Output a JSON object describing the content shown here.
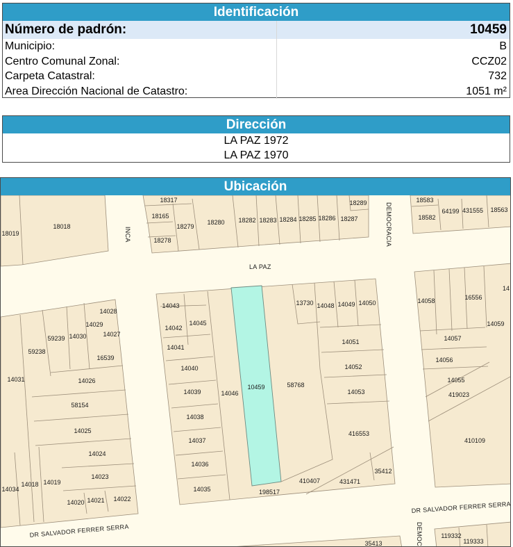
{
  "identificacion": {
    "title": "Identificación",
    "rows": [
      {
        "label": "Número de padrón:",
        "value": "10459"
      },
      {
        "label": "Municipio:",
        "value": "B"
      },
      {
        "label": "Centro Comunal Zonal:",
        "value": "CCZ02"
      },
      {
        "label": "Carpeta Catastral:",
        "value": "732"
      },
      {
        "label": "Area Dirección Nacional de Catastro:",
        "value": "1051 m²"
      }
    ]
  },
  "direccion": {
    "title": "Dirección",
    "lines": [
      "LA PAZ 1972",
      "LA PAZ 1970"
    ]
  },
  "ubicacion": {
    "title": "Ubicación",
    "map": {
      "highlight_color": "#b3f5e4",
      "block_color": "#f6ead0",
      "street_color": "#fffbeb",
      "streets": [
        "LA PAZ",
        "INCA",
        "DEMOCRACIA",
        "DR SALVADOR FERRER SERRA",
        "DR SALVADOR FERRER SERRA",
        "DEMOCR"
      ],
      "parcels": [
        "10459",
        "18317",
        "18165",
        "18279",
        "18278",
        "18280",
        "18282",
        "18283",
        "18284",
        "18285",
        "18286",
        "18287",
        "18289",
        "18018",
        "18019",
        "18583",
        "18582",
        "64199",
        "431555",
        "18563",
        "14043",
        "14042",
        "14041",
        "14045",
        "14040",
        "14039",
        "14038",
        "14037",
        "14036",
        "14035",
        "14046",
        "13730",
        "14048",
        "14049",
        "14050",
        "14051",
        "14052",
        "14053",
        "58768",
        "416553",
        "410407",
        "431471",
        "35412",
        "198517",
        "14028",
        "14029",
        "14027",
        "59239",
        "14030",
        "59238",
        "16539",
        "14031",
        "14026",
        "58154",
        "14025",
        "14024",
        "14023",
        "14034",
        "14018",
        "14019",
        "14020",
        "14021",
        "14022",
        "14058",
        "16556",
        "14059",
        "14057",
        "14056",
        "14055",
        "419023",
        "410109",
        "35413",
        "119332",
        "119333",
        "14"
      ]
    }
  }
}
